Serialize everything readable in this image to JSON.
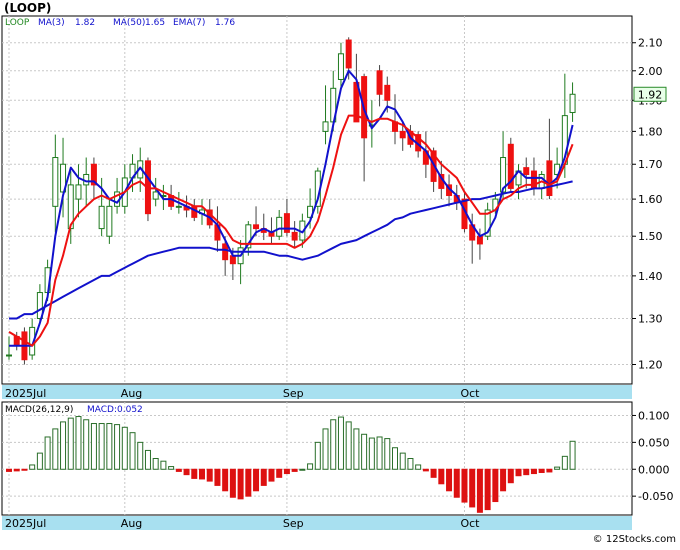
{
  "title": "(LOOP)",
  "watermark": "© 12Stocks.com",
  "colors": {
    "background": "#ffffff",
    "frame": "#000000",
    "grid": "#c8c8c8",
    "up_fill": "#ffffff",
    "up_stroke": "#1f7a1f",
    "down_fill": "#ee1111",
    "ma_short": "#1111cc",
    "ma_long": "#1111cc",
    "ema": "#ee1111",
    "price_tag_fill": "#e8ffe8",
    "price_tag_stroke": "#2a8a2a",
    "macd_pos_stroke": "#2a6e2a",
    "macd_neg_fill": "#dd1111",
    "axis_band": "#a8e0f0",
    "legend_ticker": "#228822",
    "legend_ma": "#1111cc",
    "legend_ema": "#cc1111",
    "macd_legend": "#1111cc"
  },
  "legend": {
    "ticker": "LOOP",
    "ma_short": "MA(3)",
    "ma_short_val": "1.82",
    "ma_long": "MA(50)",
    "ma_long_val": "1.65",
    "ema": "EMA(7)",
    "ema_val": "1.76"
  },
  "macd_legend": {
    "label": "MACD(26,12,9)",
    "value": "MACD:0.052"
  },
  "last_price": "1.92",
  "chart_data": [
    {
      "type": "candlestick",
      "title": "(LOOP)",
      "y_scale": "log",
      "ylim": [
        1.16,
        2.2
      ],
      "y_ticks": [
        1.2,
        1.3,
        1.4,
        1.5,
        1.6,
        1.7,
        1.8,
        1.9,
        2.0,
        2.1
      ],
      "y_tick_labels": [
        "1.20",
        "1.30",
        "1.40",
        "1.50",
        "1.60",
        "1.70",
        "1.80",
        "1.90",
        "2.00",
        "2.10"
      ],
      "x_labels": [
        {
          "label": "2025Jul",
          "bar": 0
        },
        {
          "label": "Aug",
          "bar": 15
        },
        {
          "label": "Sep",
          "bar": 36
        },
        {
          "label": "Oct",
          "bar": 59
        }
      ],
      "grid": true,
      "candles": [
        [
          1.22,
          1.26,
          1.21,
          1.22
        ],
        [
          1.26,
          1.27,
          1.23,
          1.24
        ],
        [
          1.27,
          1.28,
          1.2,
          1.21
        ],
        [
          1.22,
          1.3,
          1.21,
          1.28
        ],
        [
          1.3,
          1.38,
          1.29,
          1.36
        ],
        [
          1.36,
          1.44,
          1.34,
          1.42
        ],
        [
          1.58,
          1.79,
          1.51,
          1.72
        ],
        [
          1.62,
          1.78,
          1.55,
          1.7
        ],
        [
          1.52,
          1.68,
          1.48,
          1.64
        ],
        [
          1.6,
          1.7,
          1.55,
          1.64
        ],
        [
          1.64,
          1.72,
          1.58,
          1.67
        ],
        [
          1.7,
          1.72,
          1.6,
          1.64
        ],
        [
          1.52,
          1.66,
          1.5,
          1.58
        ],
        [
          1.5,
          1.6,
          1.48,
          1.58
        ],
        [
          1.58,
          1.66,
          1.56,
          1.62
        ],
        [
          1.58,
          1.7,
          1.56,
          1.66
        ],
        [
          1.66,
          1.73,
          1.62,
          1.7
        ],
        [
          1.66,
          1.75,
          1.62,
          1.71
        ],
        [
          1.71,
          1.72,
          1.54,
          1.56
        ],
        [
          1.6,
          1.66,
          1.58,
          1.62
        ],
        [
          1.61,
          1.64,
          1.57,
          1.61
        ],
        [
          1.61,
          1.64,
          1.57,
          1.58
        ],
        [
          1.58,
          1.62,
          1.56,
          1.58
        ],
        [
          1.58,
          1.61,
          1.55,
          1.57
        ],
        [
          1.58,
          1.6,
          1.54,
          1.55
        ],
        [
          1.56,
          1.6,
          1.53,
          1.57
        ],
        [
          1.57,
          1.6,
          1.52,
          1.53
        ],
        [
          1.53,
          1.58,
          1.46,
          1.49
        ],
        [
          1.48,
          1.5,
          1.4,
          1.44
        ],
        [
          1.45,
          1.47,
          1.39,
          1.43
        ],
        [
          1.43,
          1.49,
          1.38,
          1.47
        ],
        [
          1.47,
          1.54,
          1.45,
          1.53
        ],
        [
          1.53,
          1.58,
          1.5,
          1.52
        ],
        [
          1.52,
          1.56,
          1.49,
          1.51
        ],
        [
          1.51,
          1.55,
          1.48,
          1.5
        ],
        [
          1.5,
          1.57,
          1.49,
          1.55
        ],
        [
          1.56,
          1.6,
          1.5,
          1.51
        ],
        [
          1.51,
          1.54,
          1.47,
          1.49
        ],
        [
          1.49,
          1.56,
          1.47,
          1.54
        ],
        [
          1.55,
          1.63,
          1.52,
          1.58
        ],
        [
          1.58,
          1.69,
          1.56,
          1.68
        ],
        [
          1.8,
          1.95,
          1.76,
          1.83
        ],
        [
          1.83,
          2.0,
          1.8,
          1.94
        ],
        [
          1.97,
          2.1,
          1.94,
          2.06
        ],
        [
          2.11,
          2.12,
          1.97,
          2.01
        ],
        [
          1.96,
          2.06,
          1.9,
          1.83
        ],
        [
          1.98,
          1.99,
          1.65,
          1.78
        ],
        [
          1.82,
          1.9,
          1.75,
          1.82
        ],
        [
          2.0,
          2.02,
          1.88,
          1.92
        ],
        [
          1.95,
          1.98,
          1.86,
          1.9
        ],
        [
          1.83,
          1.92,
          1.76,
          1.8
        ],
        [
          1.8,
          1.83,
          1.74,
          1.78
        ],
        [
          1.8,
          1.82,
          1.75,
          1.76
        ],
        [
          1.79,
          1.8,
          1.72,
          1.74
        ],
        [
          1.74,
          1.8,
          1.66,
          1.7
        ],
        [
          1.74,
          1.75,
          1.62,
          1.65
        ],
        [
          1.67,
          1.71,
          1.6,
          1.63
        ],
        [
          1.64,
          1.67,
          1.58,
          1.61
        ],
        [
          1.61,
          1.64,
          1.57,
          1.59
        ],
        [
          1.6,
          1.62,
          1.51,
          1.52
        ],
        [
          1.53,
          1.56,
          1.43,
          1.49
        ],
        [
          1.5,
          1.52,
          1.44,
          1.48
        ],
        [
          1.5,
          1.59,
          1.49,
          1.57
        ],
        [
          1.57,
          1.62,
          1.56,
          1.6
        ],
        [
          1.62,
          1.8,
          1.6,
          1.72
        ],
        [
          1.76,
          1.78,
          1.62,
          1.63
        ],
        [
          1.64,
          1.7,
          1.6,
          1.68
        ],
        [
          1.69,
          1.72,
          1.63,
          1.67
        ],
        [
          1.68,
          1.72,
          1.61,
          1.63
        ],
        [
          1.63,
          1.68,
          1.6,
          1.67
        ],
        [
          1.71,
          1.84,
          1.6,
          1.61
        ],
        [
          1.67,
          1.75,
          1.63,
          1.7
        ],
        [
          1.7,
          1.99,
          1.66,
          1.85
        ],
        [
          1.86,
          1.96,
          1.83,
          1.92
        ]
      ],
      "series": [
        {
          "name": "MA(3)",
          "values": [
            1.24,
            1.24,
            1.24,
            1.24,
            1.29,
            1.35,
            1.5,
            1.61,
            1.69,
            1.66,
            1.65,
            1.65,
            1.63,
            1.6,
            1.59,
            1.62,
            1.66,
            1.69,
            1.66,
            1.63,
            1.6,
            1.6,
            1.59,
            1.58,
            1.57,
            1.56,
            1.55,
            1.53,
            1.49,
            1.45,
            1.45,
            1.48,
            1.51,
            1.52,
            1.51,
            1.52,
            1.52,
            1.52,
            1.51,
            1.54,
            1.6,
            1.7,
            1.82,
            1.94,
            2.0,
            1.97,
            1.87,
            1.81,
            1.84,
            1.88,
            1.87,
            1.83,
            1.78,
            1.76,
            1.74,
            1.7,
            1.66,
            1.63,
            1.61,
            1.57,
            1.53,
            1.5,
            1.51,
            1.55,
            1.63,
            1.65,
            1.68,
            1.66,
            1.66,
            1.66,
            1.64,
            1.66,
            1.72,
            1.82
          ]
        },
        {
          "name": "MA(50)",
          "values": [
            1.3,
            1.3,
            1.31,
            1.31,
            1.32,
            1.33,
            1.34,
            1.35,
            1.36,
            1.37,
            1.38,
            1.39,
            1.4,
            1.4,
            1.41,
            1.42,
            1.43,
            1.44,
            1.45,
            1.455,
            1.46,
            1.465,
            1.47,
            1.47,
            1.47,
            1.47,
            1.47,
            1.465,
            1.465,
            1.46,
            1.46,
            1.46,
            1.46,
            1.46,
            1.455,
            1.45,
            1.45,
            1.445,
            1.44,
            1.445,
            1.45,
            1.46,
            1.47,
            1.48,
            1.485,
            1.49,
            1.5,
            1.51,
            1.52,
            1.53,
            1.545,
            1.55,
            1.56,
            1.565,
            1.57,
            1.575,
            1.58,
            1.585,
            1.59,
            1.595,
            1.6,
            1.6,
            1.605,
            1.61,
            1.615,
            1.62,
            1.62,
            1.625,
            1.63,
            1.63,
            1.635,
            1.64,
            1.645,
            1.65
          ]
        },
        {
          "name": "EMA(7)",
          "values": [
            1.27,
            1.26,
            1.25,
            1.24,
            1.26,
            1.29,
            1.39,
            1.45,
            1.53,
            1.56,
            1.58,
            1.6,
            1.61,
            1.6,
            1.61,
            1.62,
            1.64,
            1.65,
            1.63,
            1.63,
            1.62,
            1.61,
            1.6,
            1.59,
            1.58,
            1.58,
            1.56,
            1.54,
            1.52,
            1.49,
            1.48,
            1.48,
            1.48,
            1.48,
            1.48,
            1.48,
            1.48,
            1.47,
            1.48,
            1.5,
            1.54,
            1.61,
            1.69,
            1.79,
            1.85,
            1.85,
            1.84,
            1.83,
            1.84,
            1.84,
            1.83,
            1.82,
            1.8,
            1.78,
            1.76,
            1.73,
            1.7,
            1.68,
            1.66,
            1.62,
            1.59,
            1.56,
            1.56,
            1.57,
            1.6,
            1.61,
            1.63,
            1.64,
            1.64,
            1.65,
            1.64,
            1.65,
            1.7,
            1.76
          ]
        }
      ]
    },
    {
      "type": "bar",
      "title": "MACD(26,12,9)",
      "ylim": [
        -0.085,
        0.125
      ],
      "y_ticks": [
        -0.05,
        0.0,
        0.05,
        0.1
      ],
      "y_tick_labels": [
        "-0.050",
        "0.000",
        "0.050",
        "0.100"
      ],
      "x_labels": [
        {
          "label": "2025Jul",
          "bar": 0
        },
        {
          "label": "Aug",
          "bar": 15
        },
        {
          "label": "Sep",
          "bar": 36
        },
        {
          "label": "Oct",
          "bar": 59
        }
      ],
      "series": [
        {
          "name": "MACD",
          "values": [
            -0.004,
            -0.003,
            -0.001,
            0.008,
            0.03,
            0.06,
            0.075,
            0.088,
            0.095,
            0.098,
            0.092,
            0.085,
            0.085,
            0.085,
            0.083,
            0.078,
            0.068,
            0.05,
            0.035,
            0.02,
            0.015,
            0.005,
            -0.004,
            -0.01,
            -0.017,
            -0.018,
            -0.022,
            -0.03,
            -0.04,
            -0.052,
            -0.055,
            -0.05,
            -0.04,
            -0.03,
            -0.022,
            -0.015,
            -0.008,
            -0.004,
            0.0,
            0.01,
            0.05,
            0.075,
            0.092,
            0.097,
            0.088,
            0.075,
            0.065,
            0.058,
            0.06,
            0.057,
            0.04,
            0.03,
            0.02,
            0.008,
            -0.003,
            -0.015,
            -0.027,
            -0.04,
            -0.052,
            -0.061,
            -0.07,
            -0.08,
            -0.075,
            -0.06,
            -0.04,
            -0.025,
            -0.012,
            -0.01,
            -0.008,
            -0.006,
            -0.005,
            0.004,
            0.024,
            0.052
          ]
        }
      ]
    }
  ]
}
